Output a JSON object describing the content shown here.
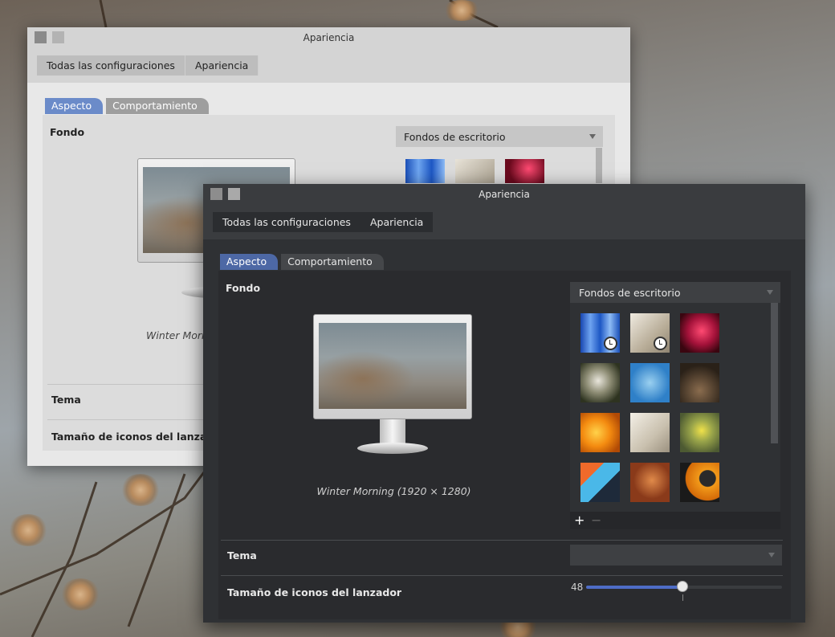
{
  "colors": {
    "accent_light": "#6b8bc9",
    "accent_dark": "#4d68a5",
    "slider_fill": "#4e6cc6",
    "window_dark_bg": "#2f3134",
    "window_light_bg": "#e8e8e8"
  },
  "back_window": {
    "title": "Apariencia",
    "breadcrumbs": [
      "Todas las configuraciones",
      "Apariencia"
    ],
    "tabs": [
      "Aspecto",
      "Comportamiento"
    ],
    "active_tab": "Aspecto",
    "fondo_label": "Fondo",
    "wallpaper_source": "Fondos de escritorio",
    "wallpaper_caption": "Winter Morn",
    "tema_label": "Tema",
    "icon_size_label": "Tamaño de iconos del lanzador"
  },
  "front_window": {
    "title": "Apariencia",
    "breadcrumbs": [
      "Todas las configuraciones",
      "Apariencia"
    ],
    "tabs": [
      "Aspecto",
      "Comportamiento"
    ],
    "active_tab": "Aspecto",
    "fondo_label": "Fondo",
    "wallpaper_source": "Fondos de escritorio",
    "wallpaper_caption": "Winter Morning (1920 × 1280)",
    "thumbnails": [
      {
        "name": "blue-stripes",
        "clock_badge": true
      },
      {
        "name": "feather-white",
        "clock_badge": true
      },
      {
        "name": "magenta-flower",
        "clock_badge": false
      },
      {
        "name": "white-blossom",
        "clock_badge": false
      },
      {
        "name": "blue-sky-seeds",
        "clock_badge": false
      },
      {
        "name": "dark-brown",
        "clock_badge": false
      },
      {
        "name": "orange-flower",
        "clock_badge": false
      },
      {
        "name": "feather-light",
        "clock_badge": false
      },
      {
        "name": "yellow-flower",
        "clock_badge": false
      },
      {
        "name": "cartoon-graffiti",
        "clock_badge": false
      },
      {
        "name": "rust-leaf",
        "clock_badge": false
      },
      {
        "name": "orange-ring",
        "clock_badge": false
      }
    ],
    "add_label": "+",
    "remove_label": "−",
    "tema_label": "Tema",
    "tema_value": "",
    "icon_size_label": "Tamaño de iconos del lanzador",
    "icon_size_value": "48",
    "icon_size_fraction": 0.5
  }
}
